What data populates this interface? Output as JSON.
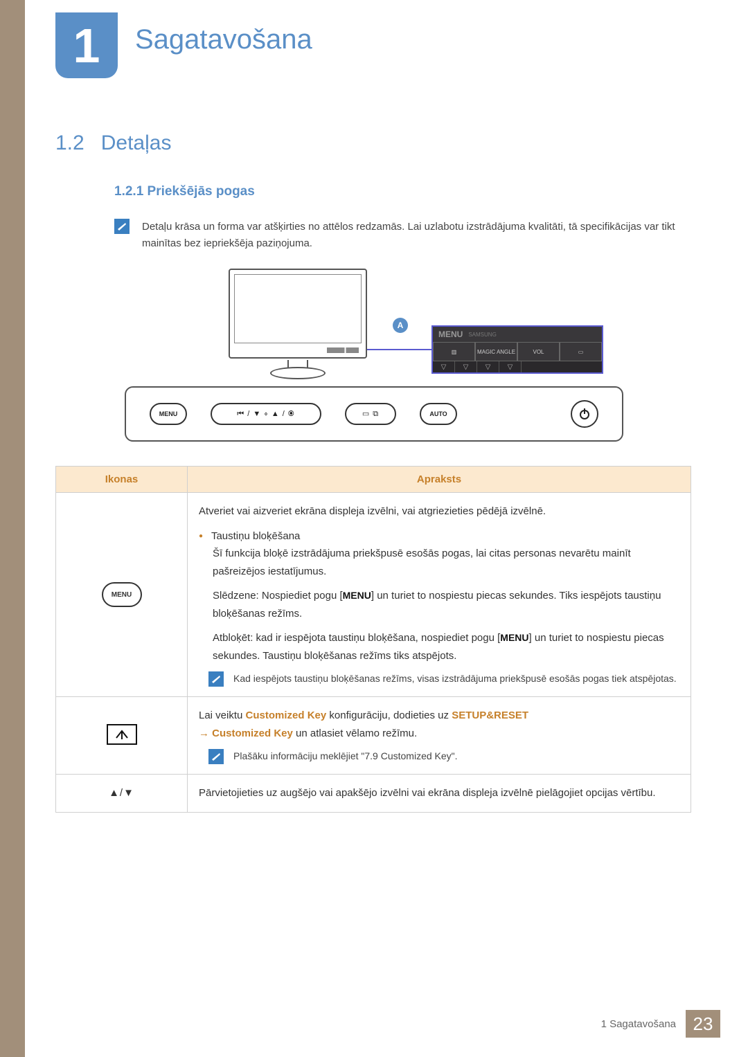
{
  "chapter": {
    "number": "1",
    "title": "Sagatavošana"
  },
  "section": {
    "num": "1.2",
    "title": "Detaļas"
  },
  "subsection": {
    "num": "1.2.1",
    "title": "Priekšējās pogas"
  },
  "note1": "Detaļu krāsa un forma var atšķirties no attēlos redzamās. Lai uzlabotu izstrādājuma kvalitāti, tā specifikācijas var tikt mainītas bez iepriekšēja paziņojuma.",
  "diagram": {
    "callout_letter": "A",
    "panel_menu": "MENU",
    "panel_brand": "SAMSUNG",
    "panel_cells": {
      "magic": "MAGIC ANGLE",
      "vol": "VOL"
    },
    "bezel": {
      "menu": "MENU",
      "symbols": "⏮ / ▼  ∘  ▲ / ⦿",
      "source": "▭ ⧉",
      "auto": "AUTO"
    }
  },
  "table": {
    "headers": {
      "icon": "Ikonas",
      "desc": "Apraksts"
    },
    "rows": {
      "menu": {
        "icon_label": "MENU",
        "p1": "Atveriet vai aizveriet ekrāna displeja izvēlni, vai atgriezieties pēdējā izvēlnē.",
        "bullet_title": "Taustiņu bloķēšana",
        "bp1": "Šī funkcija bloķē izstrādājuma priekšpusē esošās pogas, lai citas personas nevarētu mainīt pašreizējos iestatījumus.",
        "lock_pre": "Slēdzene: Nospiediet pogu [",
        "lock_btn": "MENU",
        "lock_post": "] un turiet to nospiestu piecas sekundes. Tiks iespējots taustiņu bloķēšanas režīms.",
        "unlock_pre": "Atbloķēt: kad ir iespējota taustiņu bloķēšana, nospiediet pogu [",
        "unlock_btn": "MENU",
        "unlock_post": "] un turiet to nospiestu piecas sekundes. Taustiņu bloķēšanas režīms tiks atspējots.",
        "note": "Kad iespējots taustiņu bloķēšanas režīms, visas izstrādājuma priekšpusē esošās pogas tiek atspējotas."
      },
      "ckey": {
        "line_pre": "Lai veiktu ",
        "hl1": "Customized Key",
        "line_mid": " konfigurāciju, dodieties uz ",
        "hl2": "SETUP&RESET",
        "arrow": "→",
        "hl3": "Customized Key",
        "line_post": " un atlasiet vēlamo režīmu.",
        "note": "Plašāku informāciju meklējiet \"7.9 Customized Key\"."
      },
      "arrows": {
        "icon": "▲/▼",
        "text": "Pārvietojieties uz augšējo vai apakšējo izvēlni vai ekrāna displeja izvēlnē pielāgojiet opcijas vērtību."
      }
    }
  },
  "footer": {
    "label": "1 Sagatavošana",
    "page": "23"
  }
}
